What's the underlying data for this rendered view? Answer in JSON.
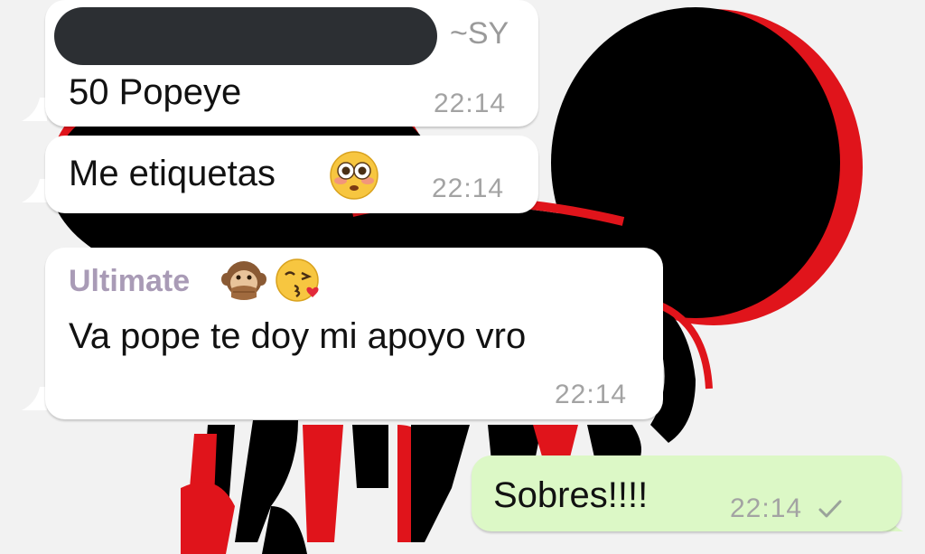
{
  "chat": {
    "messages": [
      {
        "direction": "incoming",
        "sender_tag": "~SY",
        "sender_name_redacted": true,
        "text": "50 Popeye",
        "time": "22:14"
      },
      {
        "direction": "incoming",
        "text": "Me etiquetas",
        "emoji": "flushed-face-icon",
        "time": "22:14"
      },
      {
        "direction": "incoming",
        "sender_name": "Ultimate",
        "sender_emojis": [
          "speak-no-evil-monkey-icon",
          "face-blowing-kiss-icon"
        ],
        "text": "Va pope te doy mi apoyo vro",
        "time": "22:14"
      },
      {
        "direction": "outgoing",
        "text": "Sobres!!!!",
        "time": "22:14",
        "status": "sent-check-icon"
      }
    ]
  },
  "colors": {
    "incoming_bubble": "#ffffff",
    "outgoing_bubble": "#dcf8c6",
    "sender_name": "#a99bb6",
    "timestamp": "#a3a3a3",
    "wallpaper_red": "#e0141b",
    "wallpaper_black": "#000000"
  }
}
